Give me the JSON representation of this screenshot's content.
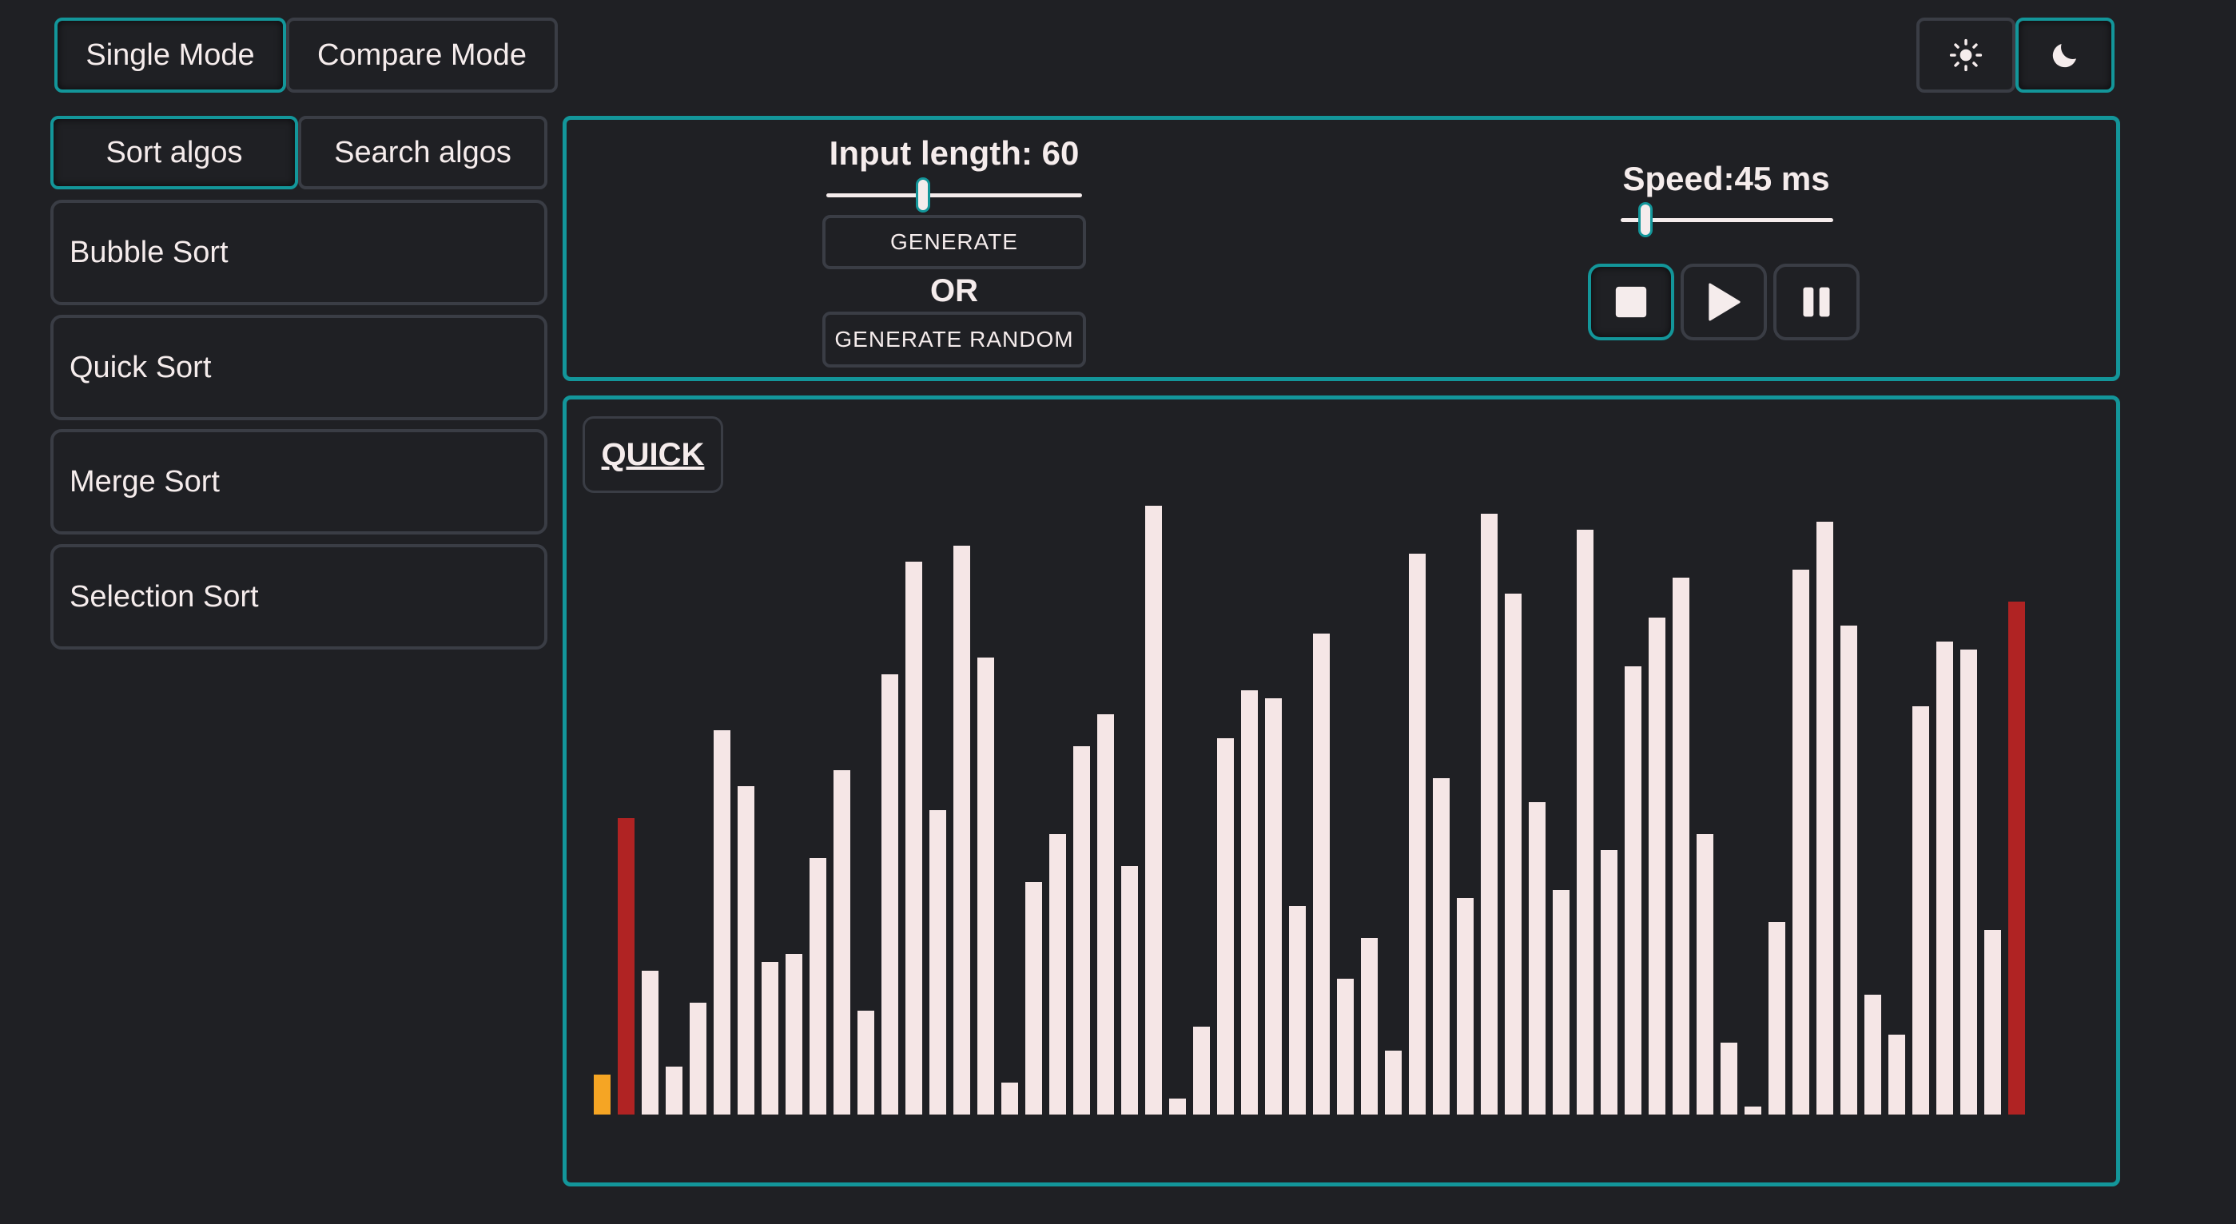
{
  "mode_tabs": {
    "single": "Single Mode",
    "compare": "Compare Mode",
    "active": "single"
  },
  "theme": {
    "light_icon": "sun-icon",
    "dark_icon": "moon-icon",
    "active": "dark"
  },
  "algo_tabs": {
    "sort": "Sort algos",
    "search": "Search algos",
    "active": "sort"
  },
  "algorithms": [
    "Bubble Sort",
    "Quick Sort",
    "Merge Sort",
    "Selection Sort"
  ],
  "controls": {
    "input_length_label": "Input length: 60",
    "input_length_value": 60,
    "generate": "GENERATE",
    "or": "OR",
    "generate_random": "GENERATE RANDOM",
    "speed_label": "Speed:45 ms",
    "speed_value_ms": 45,
    "stop_icon": "stop-icon",
    "play_icon": "play-icon",
    "pause_icon": "pause-icon"
  },
  "visualizer": {
    "title": "QUICK",
    "colors": {
      "default": "#f5e6e6",
      "pivot": "#b02323",
      "current": "#f5a524",
      "accent": "#13969a"
    }
  },
  "chart_data": {
    "type": "bar",
    "values": [
      5,
      37,
      18,
      6,
      14,
      48,
      41,
      19,
      20,
      32,
      43,
      13,
      55,
      69,
      38,
      71,
      57,
      4,
      29,
      35,
      46,
      50,
      31,
      76,
      2,
      11,
      47,
      53,
      52,
      26,
      60,
      17,
      22,
      8,
      70,
      42,
      27,
      75,
      65,
      39,
      28,
      73,
      33,
      56,
      62,
      67,
      35,
      9,
      1,
      24,
      68,
      74,
      61,
      15,
      10,
      51,
      59,
      58,
      23,
      64
    ],
    "highlights": {
      "0": "current",
      "1": "pivot",
      "59": "pivot"
    },
    "ylim": [
      0,
      76
    ]
  }
}
